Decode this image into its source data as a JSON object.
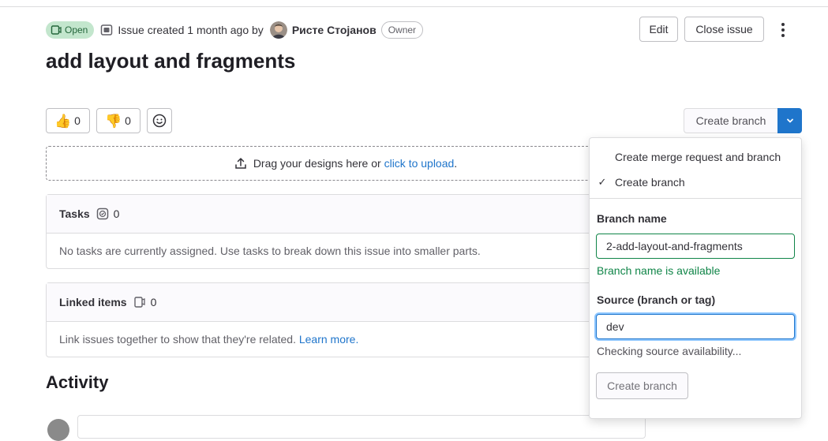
{
  "header": {
    "status": "Open",
    "created_text": "Issue created 1 month ago by",
    "author": "Ристе Стојанов",
    "role_badge": "Owner",
    "edit_label": "Edit",
    "close_label": "Close issue"
  },
  "issue": {
    "title": "add layout and fragments"
  },
  "reactions": {
    "thumbs_up": "0",
    "thumbs_down": "0"
  },
  "branch_button": {
    "label": "Create branch"
  },
  "design_drop": {
    "text": "Drag your designs here or",
    "link": "click to upload",
    "suffix": "."
  },
  "tasks": {
    "title": "Tasks",
    "count": "0",
    "empty": "No tasks are currently assigned. Use tasks to break down this issue into smaller parts."
  },
  "linked": {
    "title": "Linked items",
    "count": "0",
    "empty": "Link issues together to show that they're related.",
    "link": "Learn more."
  },
  "activity": {
    "title": "Activity"
  },
  "dropdown": {
    "options": [
      {
        "label": "Create merge request and branch",
        "checked": ""
      },
      {
        "label": "Create branch",
        "checked": "✓"
      }
    ],
    "branch_name_label": "Branch name",
    "branch_name_value": "2-add-layout-and-fragments",
    "branch_available": "Branch name is available",
    "source_label": "Source (branch or tag)",
    "source_value": "dev",
    "source_status": "Checking source availability...",
    "submit_label": "Create branch"
  },
  "colors": {
    "success": "#108548",
    "link": "#1f75cb",
    "open_badge_bg": "#c3e6cd"
  }
}
